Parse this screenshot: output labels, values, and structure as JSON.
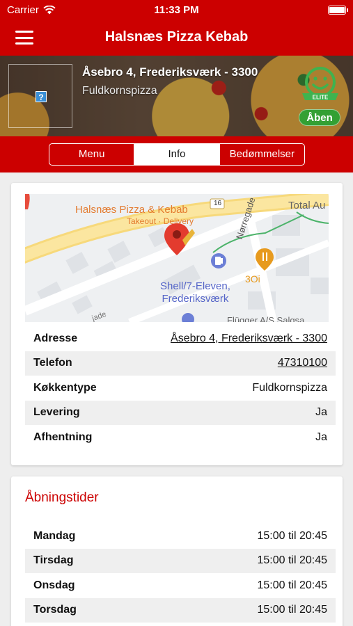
{
  "status_bar": {
    "carrier": "Carrier",
    "time": "11:33 PM"
  },
  "navbar": {
    "title": "Halsnæs Pizza Kebab"
  },
  "hero": {
    "address": "Åsebro 4, Frederiksværk - 3300",
    "cuisine": "Fuldkornspizza",
    "elite_label": "ELITE",
    "open_label": "Åben"
  },
  "tabs": [
    {
      "label": "Menu",
      "active": false
    },
    {
      "label": "Info",
      "active": true
    },
    {
      "label": "Bedømmelser",
      "active": false
    }
  ],
  "map": {
    "place_name": "Halsnæs Pizza & Kebab",
    "place_subtitle": "Takeout · Delivery",
    "road_number": "16",
    "street": "Nørregade",
    "shell_line1": "Shell/7-Eleven,",
    "shell_line2": "Frederiksværk",
    "shop": "3Oi",
    "total": "Total Au",
    "flugger": "Flügger A/S Salgsa",
    "partial_street": "jade"
  },
  "info": {
    "rows": [
      {
        "label": "Adresse",
        "value": "Åsebro 4, Frederiksværk - 3300"
      },
      {
        "label": "Telefon",
        "value": "47310100"
      },
      {
        "label": "Køkkentype",
        "value": "Fuldkornspizza"
      },
      {
        "label": "Levering",
        "value": "Ja"
      },
      {
        "label": "Afhentning",
        "value": "Ja"
      }
    ]
  },
  "hours": {
    "title": "Åbningstider",
    "rows": [
      {
        "day": "Mandag",
        "time": "15:00 til 20:45"
      },
      {
        "day": "Tirsdag",
        "time": "15:00 til 20:45"
      },
      {
        "day": "Onsdag",
        "time": "15:00 til 20:45"
      },
      {
        "day": "Torsdag",
        "time": "15:00 til 20:45"
      }
    ]
  },
  "colors": {
    "brand_red": "#cc0000",
    "open_green": "#33a033",
    "map_orange": "#e37a2e"
  }
}
